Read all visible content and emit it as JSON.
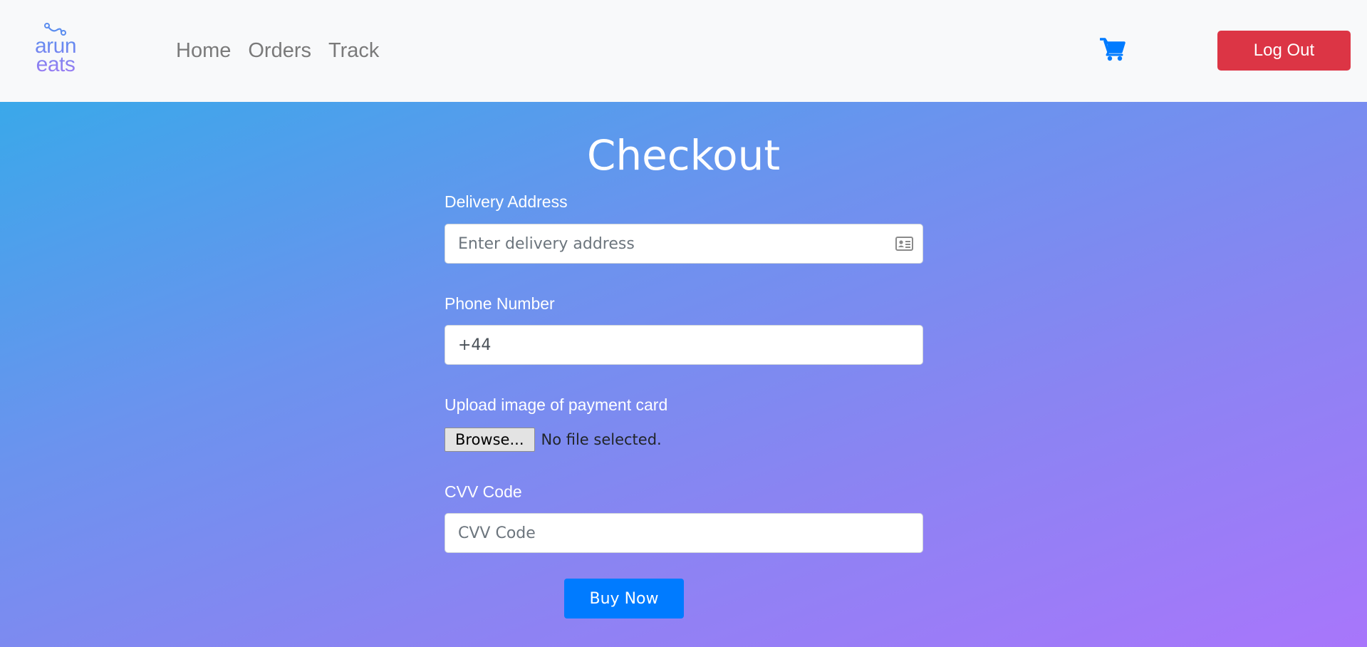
{
  "brand": {
    "line1": "arun",
    "line2": "eats",
    "logo_icon": "route-icon",
    "gradient_start": "#5b8def",
    "gradient_end": "#9b7bf2"
  },
  "nav": {
    "items": [
      {
        "label": "Home"
      },
      {
        "label": "Orders"
      },
      {
        "label": "Track"
      }
    ],
    "cart_icon": "shopping-cart-icon",
    "cart_color": "#007bff",
    "logout_label": "Log Out",
    "logout_color": "#dc3545"
  },
  "checkout": {
    "title": "Checkout",
    "address": {
      "label": "Delivery Address",
      "placeholder": "Enter delivery address",
      "value": "",
      "icon": "address-card-icon"
    },
    "phone": {
      "label": "Phone Number",
      "placeholder": "",
      "value": "+44"
    },
    "upload": {
      "label": "Upload image of payment card",
      "browse_label": "Browse...",
      "status": "No file selected."
    },
    "cvv": {
      "label": "CVV Code",
      "placeholder": "CVV Code",
      "value": ""
    },
    "buy_label": "Buy Now",
    "buy_color": "#007bff"
  },
  "background": {
    "gradient_start": "#3aa8ea",
    "gradient_end": "#a876fb"
  }
}
